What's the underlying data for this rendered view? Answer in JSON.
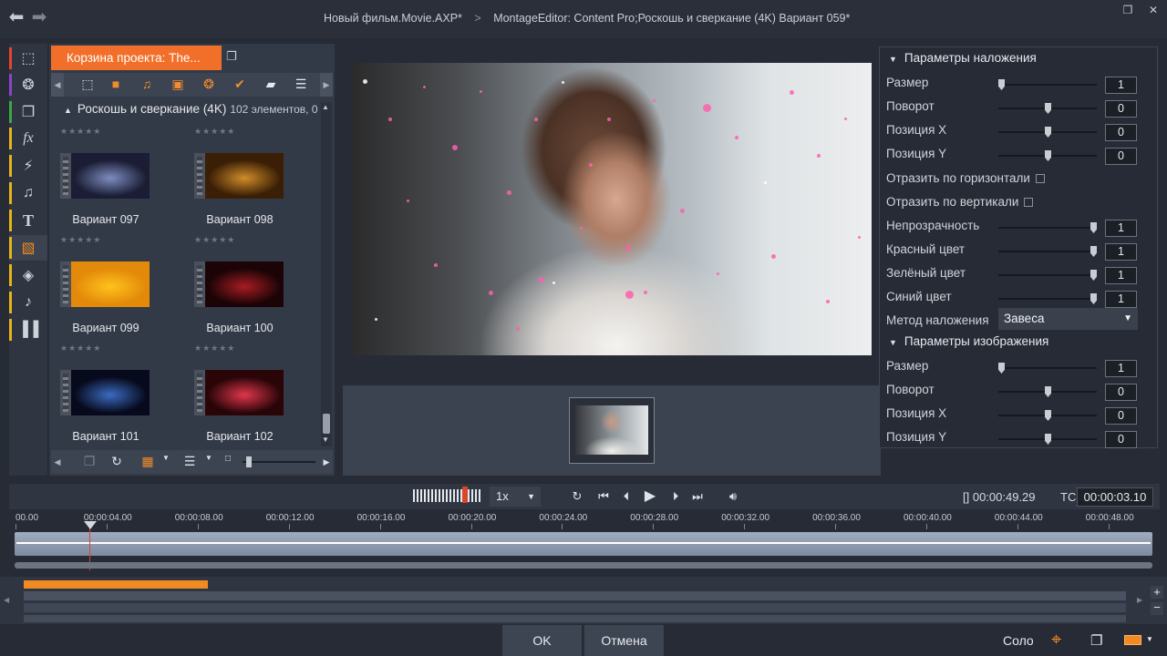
{
  "title_bar": {
    "project": "Новый фильм.Movie.AXP",
    "project_mark": "*",
    "separator": ">",
    "editor": "MontageEditor: Content Pro;Роскошь и сверкание (4K)  Вариант 059",
    "editor_mark": "*"
  },
  "library": {
    "tab_label": "Корзина проекта: The...",
    "folder": "Роскошь и сверкание (4K)",
    "item_count": "102 элементов, 0",
    "items": [
      {
        "label": "Вариант 097",
        "colors": [
          "#1a1d33",
          "#7e8cc0"
        ]
      },
      {
        "label": "Вариант 098",
        "colors": [
          "#3a1e05",
          "#d08d2a"
        ]
      },
      {
        "label": "Вариант 099",
        "colors": [
          "#e38a0a",
          "#ffc21c"
        ]
      },
      {
        "label": "Вариант 100",
        "colors": [
          "#1c0406",
          "#a71c22"
        ]
      },
      {
        "label": "Вариант 101",
        "colors": [
          "#070a1c",
          "#3b6bc0"
        ]
      },
      {
        "label": "Вариант 102",
        "colors": [
          "#2a0508",
          "#e0364c"
        ]
      }
    ],
    "stars": "★★★★★"
  },
  "params": {
    "overlay_header": "Параметры наложения",
    "overlay": [
      {
        "label": "Размер",
        "value": "1",
        "level": 0.0
      },
      {
        "label": "Поворот",
        "value": "0",
        "level": 0.5
      },
      {
        "label": "Позиция X",
        "value": "0",
        "level": 0.5
      },
      {
        "label": "Позиция Y",
        "value": "0",
        "level": 0.5
      }
    ],
    "flip_h": "Отразить по горизонтали",
    "flip_v": "Отразить по вертикали",
    "color": [
      {
        "label": "Непрозрачность",
        "value": "1",
        "level": 1.0
      },
      {
        "label": "Красный цвет",
        "value": "1",
        "level": 1.0
      },
      {
        "label": "Зелёный цвет",
        "value": "1",
        "level": 1.0
      },
      {
        "label": "Синий цвет",
        "value": "1",
        "level": 1.0
      }
    ],
    "blend_label": "Метод наложения",
    "blend_value": "Завеса",
    "image_header": "Параметры изображения",
    "image": [
      {
        "label": "Размер",
        "value": "1",
        "level": 0.0
      },
      {
        "label": "Поворот",
        "value": "0",
        "level": 0.5
      },
      {
        "label": "Позиция X",
        "value": "0",
        "level": 0.5
      },
      {
        "label": "Позиция Y",
        "value": "0",
        "level": 0.5
      }
    ]
  },
  "transport": {
    "speed": "1x",
    "total_time": "[] 00:00:49.29",
    "tc_label": "TC",
    "current_time": "00:00:03.10"
  },
  "ruler": [
    "00.00",
    "00:00:04.00",
    "00:00:08.00",
    "00:00:12.00",
    "00:00:16.00",
    "00:00:20.00",
    "00:00:24.00",
    "00:00:28.00",
    "00:00:32.00",
    "00:00:36.00",
    "00:00:40.00",
    "00:00:44.00",
    "00:00:48.00"
  ],
  "bottom": {
    "ok": "OK",
    "cancel": "Отмена",
    "solo": "Соло"
  },
  "colors": {
    "accent": "#f26f2a",
    "track_orange": "#f28a22"
  }
}
